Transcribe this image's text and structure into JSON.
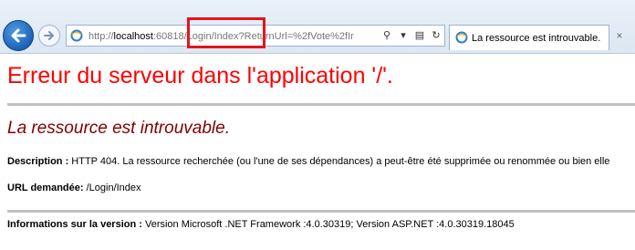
{
  "browser": {
    "url": {
      "prefix": "http://",
      "host": "localhost",
      "rest": ":60818/Login/Index?ReturnUrl=%2fVote%2fIr"
    },
    "tab_title": "La ressource est introuvable.",
    "tab_close": "×",
    "search_icon": "⚲",
    "dropdown_icon": "▾",
    "compat_icon": "▤",
    "refresh_icon": "↻"
  },
  "page": {
    "title": "Erreur du serveur dans l'application '/'.",
    "subtitle": "La ressource est introuvable.",
    "description_label": "Description :",
    "description_text": " HTTP 404. La ressource recherchée (ou l'une de ses dépendances) a peut-être été supprimée ou renommée ou bien elle",
    "url_label": "URL demandée:",
    "url_value": " /Login/Index",
    "version_label": "Informations sur la version :",
    "version_text": " Version Microsoft .NET Framework :4.0.30319; Version ASP.NET :4.0.30319.18045"
  },
  "colors": {
    "title": "#ff0000",
    "subtitle": "#800000",
    "highlight": "#e3141c",
    "rule": "#c0c0c0"
  }
}
